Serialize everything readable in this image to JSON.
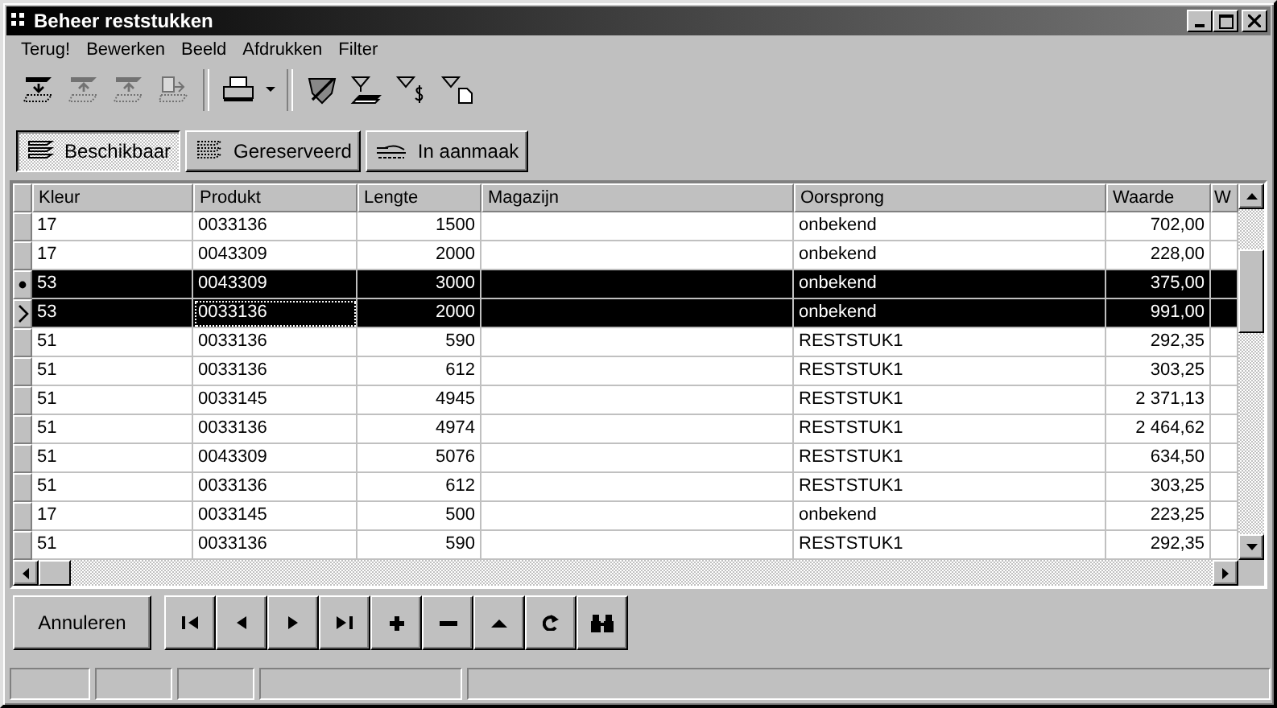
{
  "window": {
    "title": "Beheer reststukken"
  },
  "menu": [
    "Terug!",
    "Bewerken",
    "Beeld",
    "Afdrukken",
    "Filter"
  ],
  "toolbar": [
    {
      "kind": "insert",
      "disabled": false
    },
    {
      "kind": "up",
      "disabled": true
    },
    {
      "kind": "updown",
      "disabled": true
    },
    {
      "kind": "copy",
      "disabled": true
    },
    {
      "kind": "sep"
    },
    {
      "kind": "print",
      "disabled": false
    },
    {
      "kind": "dropdown",
      "disabled": false
    },
    {
      "kind": "sep"
    },
    {
      "kind": "shield",
      "disabled": false
    },
    {
      "kind": "filter-stack",
      "disabled": false
    },
    {
      "kind": "filter-dollar",
      "disabled": false
    },
    {
      "kind": "filter-page",
      "disabled": false
    }
  ],
  "filter_tabs": [
    {
      "label": "Beschikbaar",
      "kind": "stack",
      "selected": true
    },
    {
      "label": "Gereserveerd",
      "kind": "hatched",
      "selected": false
    },
    {
      "label": "In aanmaak",
      "kind": "tray",
      "selected": false
    }
  ],
  "table": {
    "columns": [
      "Kleur",
      "Produkt",
      "Lengte",
      "Magazijn",
      "Oorsprong",
      "Waarde",
      "W"
    ],
    "rows": [
      {
        "cells": [
          "17",
          "0033136",
          "1500",
          "",
          "onbekend",
          "702,00"
        ],
        "selected": false,
        "bookmarked": false,
        "current": false
      },
      {
        "cells": [
          "17",
          "0043309",
          "2000",
          "",
          "onbekend",
          "228,00"
        ],
        "selected": false,
        "bookmarked": false,
        "current": false
      },
      {
        "cells": [
          "53",
          "0043309",
          "3000",
          "",
          "onbekend",
          "375,00"
        ],
        "selected": true,
        "bookmarked": true,
        "current": false
      },
      {
        "cells": [
          "53",
          "0033136",
          "2000",
          "",
          "onbekend",
          "991,00"
        ],
        "selected": true,
        "bookmarked": false,
        "current": true
      },
      {
        "cells": [
          "51",
          "0033136",
          "590",
          "",
          "RESTSTUK1",
          "292,35"
        ],
        "selected": false,
        "bookmarked": false,
        "current": false
      },
      {
        "cells": [
          "51",
          "0033136",
          "612",
          "",
          "RESTSTUK1",
          "303,25"
        ],
        "selected": false,
        "bookmarked": false,
        "current": false
      },
      {
        "cells": [
          "51",
          "0033145",
          "4945",
          "",
          "RESTSTUK1",
          "2 371,13"
        ],
        "selected": false,
        "bookmarked": false,
        "current": false
      },
      {
        "cells": [
          "51",
          "0033136",
          "4974",
          "",
          "RESTSTUK1",
          "2 464,62"
        ],
        "selected": false,
        "bookmarked": false,
        "current": false
      },
      {
        "cells": [
          "51",
          "0043309",
          "5076",
          "",
          "RESTSTUK1",
          "634,50"
        ],
        "selected": false,
        "bookmarked": false,
        "current": false
      },
      {
        "cells": [
          "51",
          "0033136",
          "612",
          "",
          "RESTSTUK1",
          "303,25"
        ],
        "selected": false,
        "bookmarked": false,
        "current": false
      },
      {
        "cells": [
          "17",
          "0033145",
          "500",
          "",
          "onbekend",
          "223,25"
        ],
        "selected": false,
        "bookmarked": false,
        "current": false
      },
      {
        "cells": [
          "51",
          "0033136",
          "590",
          "",
          "RESTSTUK1",
          "292,35"
        ],
        "selected": false,
        "bookmarked": false,
        "current": false
      }
    ]
  },
  "cancel_button": "Annuleren",
  "navigator": [
    {
      "kind": "first"
    },
    {
      "kind": "prior"
    },
    {
      "kind": "next"
    },
    {
      "kind": "last"
    },
    {
      "kind": "insert"
    },
    {
      "kind": "delete"
    },
    {
      "kind": "post"
    },
    {
      "kind": "refresh"
    },
    {
      "kind": "find"
    }
  ]
}
